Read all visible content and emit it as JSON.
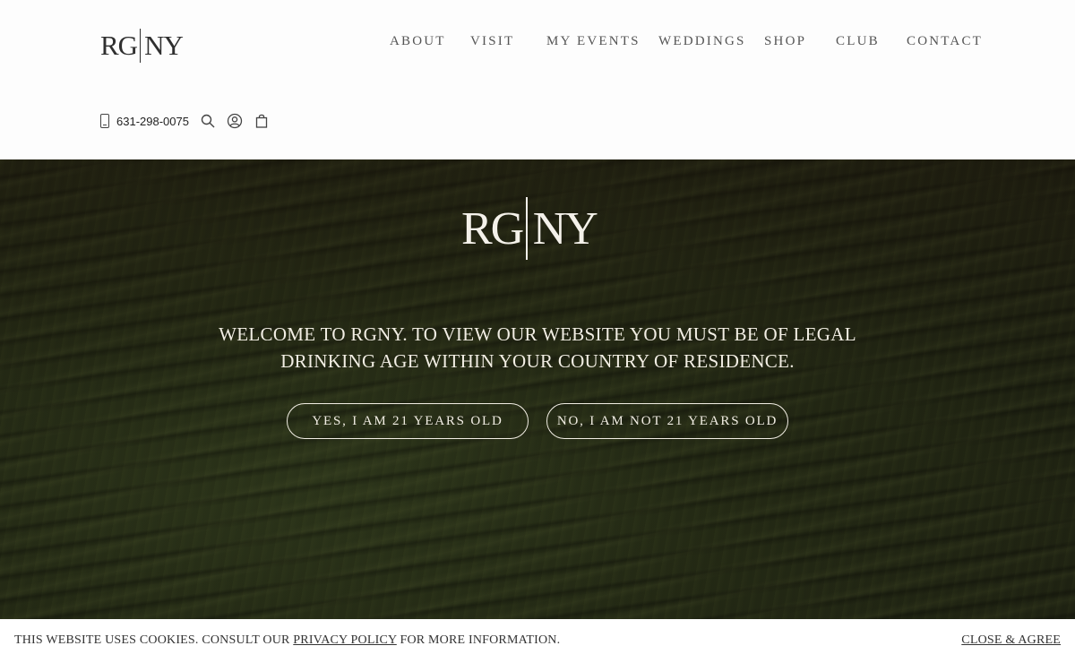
{
  "brand": {
    "left": "RG",
    "right": "NY"
  },
  "nav": [
    {
      "label": "ABOUT"
    },
    {
      "label": "VISIT"
    },
    {
      "label": "MY EVENTS"
    },
    {
      "label": "WEDDINGS"
    },
    {
      "label": "SHOP"
    },
    {
      "label": "CLUB"
    },
    {
      "label": "CONTACT"
    }
  ],
  "utility": {
    "phone": "631-298-0075",
    "icons": [
      "phone-icon",
      "search-icon",
      "account-icon",
      "cart-icon"
    ]
  },
  "age_gate": {
    "logo_left": "RG",
    "logo_right": "NY",
    "message_line1": "WELCOME TO RGNY. TO VIEW OUR WEBSITE YOU MUST BE OF LEGAL",
    "message_line2": "DRINKING AGE WITHIN YOUR COUNTRY OF RESIDENCE.",
    "yes_label": "YES, I AM 21 YEARS OLD",
    "no_label": "NO, I AM NOT 21 YEARS OLD"
  },
  "cookie_bar": {
    "text_before": "THIS WEBSITE USES COOKIES. CONSULT OUR ",
    "link_label": "PRIVACY POLICY",
    "text_after": " FOR MORE INFORMATION.",
    "close_label": "CLOSE & AGREE"
  },
  "colors": {
    "header_bg": "#fdfdfd",
    "hero_text": "#f2eee4",
    "nav_text": "#555555"
  }
}
